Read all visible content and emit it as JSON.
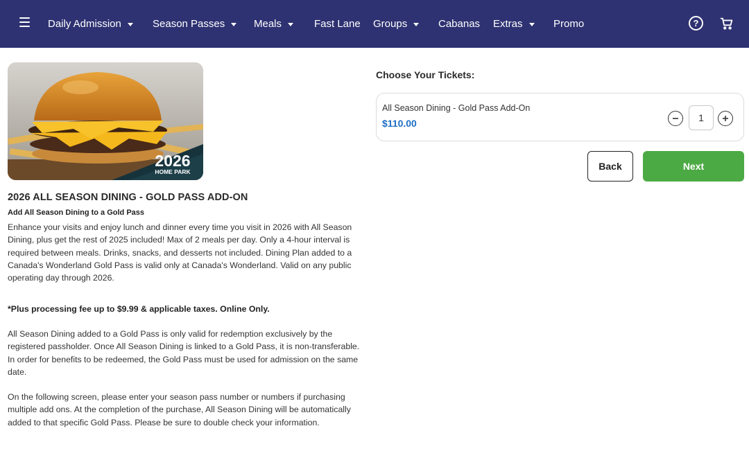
{
  "nav": {
    "items": [
      {
        "label": "Daily Admission",
        "dropdown": true
      },
      {
        "label": "Season Passes",
        "dropdown": true
      },
      {
        "label": "Meals",
        "dropdown": true
      },
      {
        "label": "Fast Lane",
        "dropdown": false
      },
      {
        "label": "Groups",
        "dropdown": true
      },
      {
        "label": "Cabanas",
        "dropdown": false
      },
      {
        "label": "Extras",
        "dropdown": true
      },
      {
        "label": "Promo",
        "dropdown": false
      }
    ],
    "help_symbol": "?",
    "icons": [
      "hamburger-menu-icon",
      "help-icon",
      "cart-icon"
    ],
    "bar_color": "#2e3272"
  },
  "hero": {
    "badge_year": "2026",
    "badge_text": "HOME PARK"
  },
  "product": {
    "title": "2026 ALL SEASON DINING - GOLD PASS ADD-ON",
    "subtitle": "Add All Season Dining to a Gold Pass",
    "paragraphs": [
      "Enhance your visits and enjoy lunch and dinner every time you visit in 2026 with All Season Dining, plus get the rest of 2025 included! Max of 2 meals per day. Only a 4-hour interval is required between meals. Drinks, snacks, and desserts not included. Dining Plan added to a Canada's Wonderland Gold Pass is valid only at Canada's Wonderland. Valid on any public operating day through 2026.",
      "*Plus processing fee up to $9.99 & applicable taxes. Online Only.",
      "All Season Dining added to a Gold Pass is only valid for redemption exclusively by the registered passholder. Once All Season Dining is linked to a Gold Pass, it is non-transferable. In order for benefits to be redeemed, the Gold Pass must be used for admission on the same date.",
      "On the following screen, please enter your season pass number or numbers if purchasing multiple add ons. At the completion of the purchase, All Season Dining will be automatically added to that specific Gold Pass. Please be sure to double check your information."
    ]
  },
  "tickets": {
    "heading": "Choose Your Tickets:",
    "item": {
      "name": "All Season Dining - Gold Pass Add-On",
      "price": "$110.00",
      "quantity": "1"
    },
    "price_color": "#1f6fc4"
  },
  "actions": {
    "back_label": "Back",
    "next_label": "Next",
    "next_color": "#4caa44"
  }
}
